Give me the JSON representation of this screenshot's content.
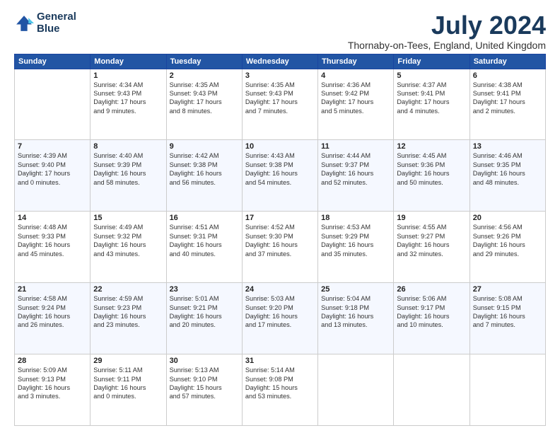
{
  "logo": {
    "line1": "General",
    "line2": "Blue"
  },
  "title": "July 2024",
  "subtitle": "Thornaby-on-Tees, England, United Kingdom",
  "headers": [
    "Sunday",
    "Monday",
    "Tuesday",
    "Wednesday",
    "Thursday",
    "Friday",
    "Saturday"
  ],
  "weeks": [
    [
      {
        "day": "",
        "content": ""
      },
      {
        "day": "1",
        "content": "Sunrise: 4:34 AM\nSunset: 9:43 PM\nDaylight: 17 hours\nand 9 minutes."
      },
      {
        "day": "2",
        "content": "Sunrise: 4:35 AM\nSunset: 9:43 PM\nDaylight: 17 hours\nand 8 minutes."
      },
      {
        "day": "3",
        "content": "Sunrise: 4:35 AM\nSunset: 9:43 PM\nDaylight: 17 hours\nand 7 minutes."
      },
      {
        "day": "4",
        "content": "Sunrise: 4:36 AM\nSunset: 9:42 PM\nDaylight: 17 hours\nand 5 minutes."
      },
      {
        "day": "5",
        "content": "Sunrise: 4:37 AM\nSunset: 9:41 PM\nDaylight: 17 hours\nand 4 minutes."
      },
      {
        "day": "6",
        "content": "Sunrise: 4:38 AM\nSunset: 9:41 PM\nDaylight: 17 hours\nand 2 minutes."
      }
    ],
    [
      {
        "day": "7",
        "content": "Sunrise: 4:39 AM\nSunset: 9:40 PM\nDaylight: 17 hours\nand 0 minutes."
      },
      {
        "day": "8",
        "content": "Sunrise: 4:40 AM\nSunset: 9:39 PM\nDaylight: 16 hours\nand 58 minutes."
      },
      {
        "day": "9",
        "content": "Sunrise: 4:42 AM\nSunset: 9:38 PM\nDaylight: 16 hours\nand 56 minutes."
      },
      {
        "day": "10",
        "content": "Sunrise: 4:43 AM\nSunset: 9:38 PM\nDaylight: 16 hours\nand 54 minutes."
      },
      {
        "day": "11",
        "content": "Sunrise: 4:44 AM\nSunset: 9:37 PM\nDaylight: 16 hours\nand 52 minutes."
      },
      {
        "day": "12",
        "content": "Sunrise: 4:45 AM\nSunset: 9:36 PM\nDaylight: 16 hours\nand 50 minutes."
      },
      {
        "day": "13",
        "content": "Sunrise: 4:46 AM\nSunset: 9:35 PM\nDaylight: 16 hours\nand 48 minutes."
      }
    ],
    [
      {
        "day": "14",
        "content": "Sunrise: 4:48 AM\nSunset: 9:33 PM\nDaylight: 16 hours\nand 45 minutes."
      },
      {
        "day": "15",
        "content": "Sunrise: 4:49 AM\nSunset: 9:32 PM\nDaylight: 16 hours\nand 43 minutes."
      },
      {
        "day": "16",
        "content": "Sunrise: 4:51 AM\nSunset: 9:31 PM\nDaylight: 16 hours\nand 40 minutes."
      },
      {
        "day": "17",
        "content": "Sunrise: 4:52 AM\nSunset: 9:30 PM\nDaylight: 16 hours\nand 37 minutes."
      },
      {
        "day": "18",
        "content": "Sunrise: 4:53 AM\nSunset: 9:29 PM\nDaylight: 16 hours\nand 35 minutes."
      },
      {
        "day": "19",
        "content": "Sunrise: 4:55 AM\nSunset: 9:27 PM\nDaylight: 16 hours\nand 32 minutes."
      },
      {
        "day": "20",
        "content": "Sunrise: 4:56 AM\nSunset: 9:26 PM\nDaylight: 16 hours\nand 29 minutes."
      }
    ],
    [
      {
        "day": "21",
        "content": "Sunrise: 4:58 AM\nSunset: 9:24 PM\nDaylight: 16 hours\nand 26 minutes."
      },
      {
        "day": "22",
        "content": "Sunrise: 4:59 AM\nSunset: 9:23 PM\nDaylight: 16 hours\nand 23 minutes."
      },
      {
        "day": "23",
        "content": "Sunrise: 5:01 AM\nSunset: 9:21 PM\nDaylight: 16 hours\nand 20 minutes."
      },
      {
        "day": "24",
        "content": "Sunrise: 5:03 AM\nSunset: 9:20 PM\nDaylight: 16 hours\nand 17 minutes."
      },
      {
        "day": "25",
        "content": "Sunrise: 5:04 AM\nSunset: 9:18 PM\nDaylight: 16 hours\nand 13 minutes."
      },
      {
        "day": "26",
        "content": "Sunrise: 5:06 AM\nSunset: 9:17 PM\nDaylight: 16 hours\nand 10 minutes."
      },
      {
        "day": "27",
        "content": "Sunrise: 5:08 AM\nSunset: 9:15 PM\nDaylight: 16 hours\nand 7 minutes."
      }
    ],
    [
      {
        "day": "28",
        "content": "Sunrise: 5:09 AM\nSunset: 9:13 PM\nDaylight: 16 hours\nand 3 minutes."
      },
      {
        "day": "29",
        "content": "Sunrise: 5:11 AM\nSunset: 9:11 PM\nDaylight: 16 hours\nand 0 minutes."
      },
      {
        "day": "30",
        "content": "Sunrise: 5:13 AM\nSunset: 9:10 PM\nDaylight: 15 hours\nand 57 minutes."
      },
      {
        "day": "31",
        "content": "Sunrise: 5:14 AM\nSunset: 9:08 PM\nDaylight: 15 hours\nand 53 minutes."
      },
      {
        "day": "",
        "content": ""
      },
      {
        "day": "",
        "content": ""
      },
      {
        "day": "",
        "content": ""
      }
    ]
  ]
}
